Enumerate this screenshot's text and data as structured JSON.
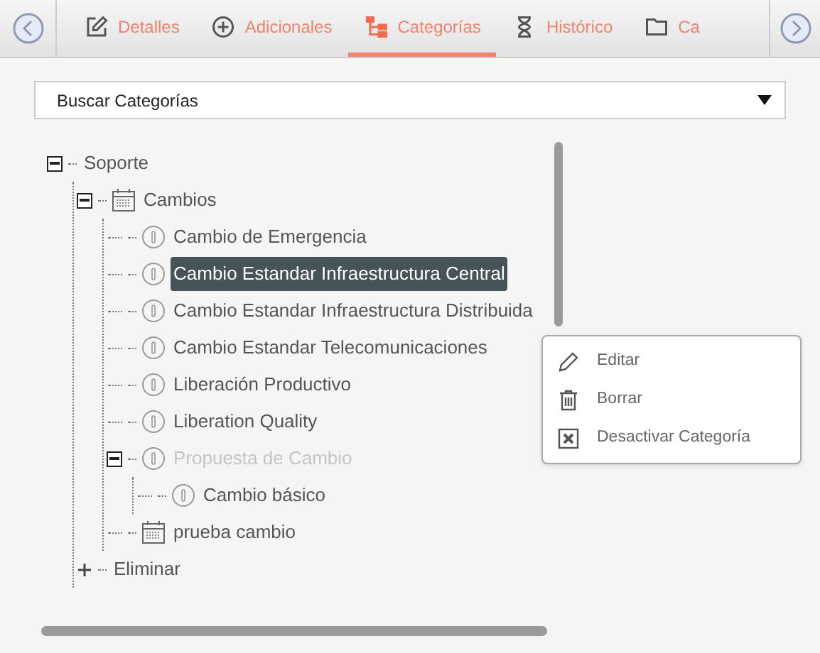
{
  "tabs": [
    {
      "label": "Detalles",
      "kind": "edit",
      "selected": false
    },
    {
      "label": "Adicionales",
      "kind": "plus",
      "selected": false
    },
    {
      "label": "Categorías",
      "kind": "tree",
      "selected": true
    },
    {
      "label": "Histórico",
      "kind": "hourglass",
      "selected": false
    },
    {
      "label": "Ca",
      "kind": "folder",
      "selected": false
    }
  ],
  "search": {
    "value": "Buscar Categorías"
  },
  "tree": [
    {
      "label": "Soporte",
      "expanded": true,
      "selected": false,
      "disabled": false,
      "children": [
        {
          "label": "Cambios",
          "kind": "calendar",
          "expanded": true,
          "selected": false,
          "disabled": false,
          "children": [
            {
              "label": "Cambio de Emergencia",
              "kind": "info",
              "selected": false,
              "disabled": false
            },
            {
              "label": "Cambio Estandar Infraestructura Central",
              "kind": "info",
              "selected": true,
              "disabled": false
            },
            {
              "label": "Cambio Estandar Infraestructura Distribuida",
              "kind": "info",
              "selected": false,
              "disabled": false
            },
            {
              "label": "Cambio Estandar Telecomunicaciones",
              "kind": "info",
              "selected": false,
              "disabled": false
            },
            {
              "label": "Liberación Productivo",
              "kind": "info",
              "selected": false,
              "disabled": false
            },
            {
              "label": "Liberation Quality",
              "kind": "info",
              "selected": false,
              "disabled": false
            },
            {
              "label": "Propuesta de Cambio",
              "kind": "info",
              "expanded": true,
              "selected": false,
              "disabled": true,
              "children": [
                {
                  "label": "Cambio básico",
                  "kind": "info",
                  "selected": false,
                  "disabled": false
                }
              ]
            },
            {
              "label": "prueba cambio",
              "kind": "calendar",
              "selected": false,
              "disabled": false
            }
          ]
        },
        {
          "label": "Eliminar",
          "expanded": false,
          "selected": false,
          "disabled": false
        }
      ]
    }
  ],
  "context_menu": [
    {
      "label": "Editar",
      "kind": "pencil"
    },
    {
      "label": "Borrar",
      "kind": "trash"
    },
    {
      "label": "Desactivar Categoría",
      "kind": "xbox"
    }
  ]
}
